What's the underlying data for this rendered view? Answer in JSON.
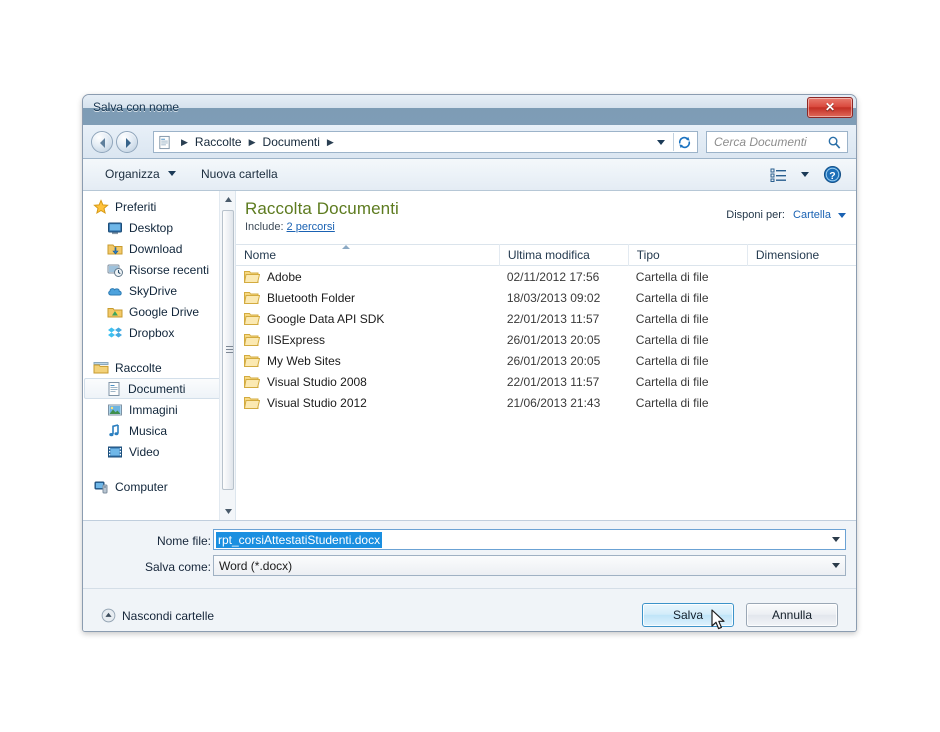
{
  "dialog": {
    "title": "Salva con nome",
    "close_label": "✕"
  },
  "navbar": {
    "back_icon": "back-arrow-icon",
    "forward_icon": "forward-arrow-icon",
    "breadcrumb": [
      "Raccolte",
      "Documenti"
    ],
    "separator": "▸",
    "search_placeholder": "Cerca Documenti",
    "refresh_icon": "refresh-icon"
  },
  "toolbar": {
    "organize_label": "Organizza",
    "new_folder_label": "Nuova cartella",
    "view_icon": "view-mode-icon",
    "help_icon": "help-icon"
  },
  "sidebar": {
    "items": [
      {
        "label": "Preferiti",
        "icon": "star-icon",
        "type": "group"
      },
      {
        "label": "Desktop",
        "icon": "desktop-icon",
        "type": "child"
      },
      {
        "label": "Download",
        "icon": "download-icon",
        "type": "child"
      },
      {
        "label": "Risorse recenti",
        "icon": "recent-icon",
        "type": "child"
      },
      {
        "label": "SkyDrive",
        "icon": "cloud-icon",
        "type": "child"
      },
      {
        "label": "Google Drive",
        "icon": "drive-icon",
        "type": "child"
      },
      {
        "label": "Dropbox",
        "icon": "dropbox-icon",
        "type": "child"
      },
      {
        "label": "Raccolte",
        "icon": "libraries-icon",
        "type": "group"
      },
      {
        "label": "Documenti",
        "icon": "document-icon",
        "type": "child",
        "selected": true
      },
      {
        "label": "Immagini",
        "icon": "pictures-icon",
        "type": "child"
      },
      {
        "label": "Musica",
        "icon": "music-icon",
        "type": "child"
      },
      {
        "label": "Video",
        "icon": "video-icon",
        "type": "child"
      },
      {
        "label": "Computer",
        "icon": "computer-icon",
        "type": "group"
      }
    ]
  },
  "library": {
    "title": "Raccolta Documenti",
    "include_label": "Include:",
    "include_link": "2 percorsi",
    "arrange_label": "Disponi per:",
    "arrange_value": "Cartella"
  },
  "columns": {
    "name": "Nome",
    "modified": "Ultima modifica",
    "type": "Tipo",
    "size": "Dimensione"
  },
  "files": [
    {
      "name": "Adobe",
      "modified": "02/11/2012 17:56",
      "type": "Cartella di file",
      "size": ""
    },
    {
      "name": "Bluetooth Folder",
      "modified": "18/03/2013 09:02",
      "type": "Cartella di file",
      "size": ""
    },
    {
      "name": "Google Data API SDK",
      "modified": "22/01/2013 11:57",
      "type": "Cartella di file",
      "size": ""
    },
    {
      "name": "IISExpress",
      "modified": "26/01/2013 20:05",
      "type": "Cartella di file",
      "size": ""
    },
    {
      "name": "My Web Sites",
      "modified": "26/01/2013 20:05",
      "type": "Cartella di file",
      "size": ""
    },
    {
      "name": "Visual Studio 2008",
      "modified": "22/01/2013 11:57",
      "type": "Cartella di file",
      "size": ""
    },
    {
      "name": "Visual Studio 2012",
      "modified": "21/06/2013 21:43",
      "type": "Cartella di file",
      "size": ""
    }
  ],
  "form": {
    "filename_label": "Nome file:",
    "filename_value": "rpt_corsiAttestatiStudenti.docx",
    "filetype_label": "Salva come:",
    "filetype_value": "Word (*.docx)"
  },
  "footer": {
    "hide_folders_label": "Nascondi cartelle",
    "save_label": "Salva",
    "cancel_label": "Annulla"
  },
  "colors": {
    "titlebar": "#7d9cb5",
    "library_title": "#5d7b1f",
    "link": "#1a62b3",
    "selection": "#1a8fe0",
    "save_button_border": "#3c93c9",
    "close_button": "#c22d22"
  }
}
